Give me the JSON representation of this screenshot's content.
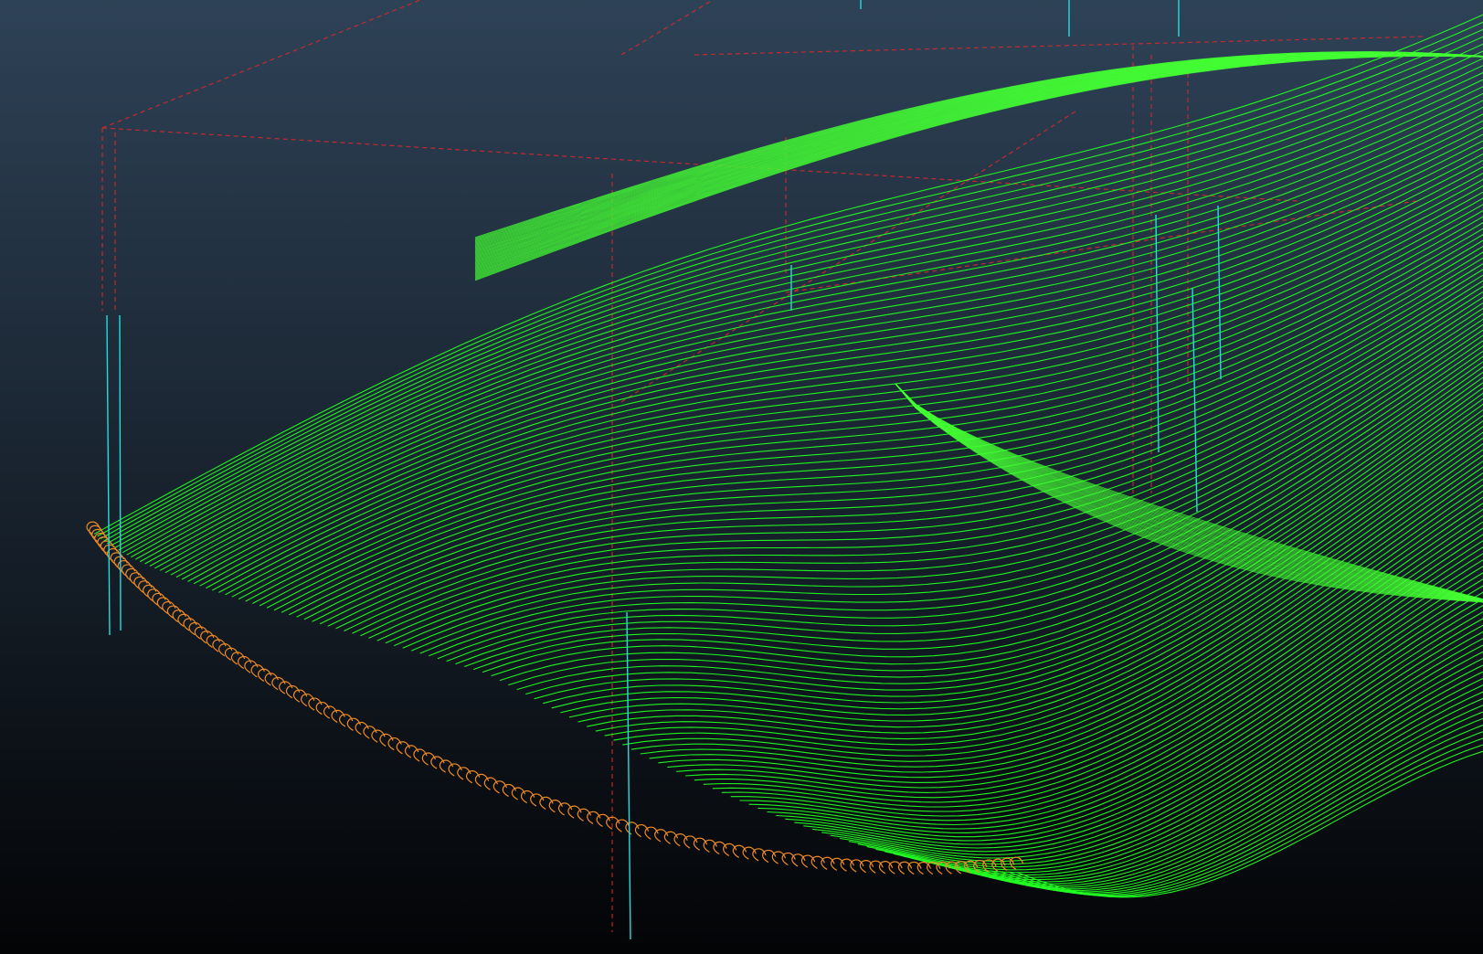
{
  "viewport": {
    "background": {
      "top_color": "#2e4257",
      "bottom_color": "#030406"
    },
    "colors": {
      "toolpath": "#22ff22",
      "toolpath_dense": "#44ff33",
      "link_moves": "#f08a24",
      "rapid_moves": "#e02828",
      "plunge_moves": "#22dddd"
    },
    "icons": {
      "scene": "toolpath-viewport-icon"
    }
  }
}
